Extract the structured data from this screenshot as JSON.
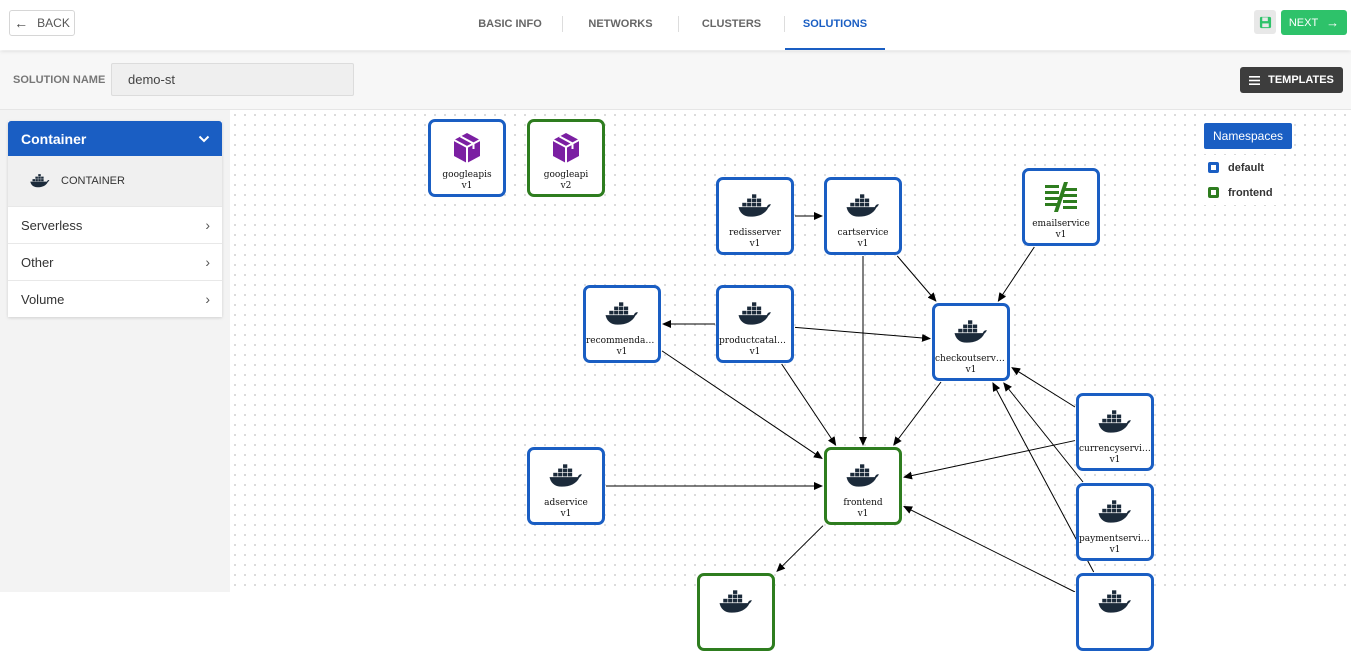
{
  "header": {
    "back_label": "BACK",
    "tabs": [
      {
        "label": "BASIC INFO",
        "active": false
      },
      {
        "label": "NETWORKS",
        "active": false
      },
      {
        "label": "CLUSTERS",
        "active": false
      },
      {
        "label": "SOLUTIONS",
        "active": true
      }
    ],
    "next_label": "NEXT"
  },
  "solution": {
    "name_label": "SOLUTION NAME",
    "name_value": "demo-st",
    "templates_label": "TEMPLATES"
  },
  "sidebar": {
    "open_section": "Container",
    "open_items": [
      {
        "label": "CONTAINER",
        "icon": "docker-icon"
      }
    ],
    "sections": [
      "Serverless",
      "Other",
      "Volume"
    ]
  },
  "namespaces": {
    "title": "Namespaces",
    "items": [
      {
        "label": "default",
        "color": "#1a5ec3"
      },
      {
        "label": "frontend",
        "color": "#2e7d1f"
      }
    ]
  },
  "colors": {
    "accent": "#1a5ec3",
    "frontend": "#2e7d1f",
    "next": "#2ec26a",
    "package": "#7b1fa2"
  },
  "graph": {
    "nodes": [
      {
        "id": "googleapis",
        "name": "googleapis",
        "version": "v1",
        "namespace": "default",
        "icon": "package-icon"
      },
      {
        "id": "googleapi",
        "name": "googleapi",
        "version": "v2",
        "namespace": "frontend",
        "icon": "package-icon"
      },
      {
        "id": "redisserver",
        "name": "redisserver",
        "version": "v1",
        "namespace": "default",
        "icon": "docker-icon"
      },
      {
        "id": "cartservice",
        "name": "cartservice",
        "version": "v1",
        "namespace": "default",
        "icon": "docker-icon"
      },
      {
        "id": "emailservice",
        "name": "emailservice",
        "version": "v1",
        "namespace": "default",
        "icon": "email-service-icon"
      },
      {
        "id": "recommendation",
        "name": "recommendatio…",
        "version": "v1",
        "namespace": "default",
        "icon": "docker-icon"
      },
      {
        "id": "productcatalog",
        "name": "productcatalog…",
        "version": "v1",
        "namespace": "default",
        "icon": "docker-icon"
      },
      {
        "id": "checkoutservice",
        "name": "checkoutservice",
        "version": "v1",
        "namespace": "default",
        "icon": "docker-icon"
      },
      {
        "id": "currencyservice",
        "name": "currencyservice",
        "version": "v1",
        "namespace": "default",
        "icon": "docker-icon"
      },
      {
        "id": "adservice",
        "name": "adservice",
        "version": "v1",
        "namespace": "default",
        "icon": "docker-icon"
      },
      {
        "id": "frontend",
        "name": "frontend",
        "version": "v1",
        "namespace": "frontend",
        "icon": "docker-icon"
      },
      {
        "id": "paymentservice",
        "name": "paymentservice",
        "version": "v1",
        "namespace": "default",
        "icon": "docker-icon"
      },
      {
        "id": "bottom-left",
        "name": "",
        "version": "",
        "namespace": "frontend",
        "icon": "docker-icon"
      },
      {
        "id": "bottom-right",
        "name": "",
        "version": "",
        "namespace": "default",
        "icon": "docker-icon"
      }
    ],
    "edges": [
      {
        "from": "redisserver",
        "to": "cartservice"
      },
      {
        "from": "cartservice",
        "to": "checkoutservice"
      },
      {
        "from": "emailservice",
        "to": "checkoutservice"
      },
      {
        "from": "cartservice",
        "to": "frontend"
      },
      {
        "from": "productcatalog",
        "to": "recommendation"
      },
      {
        "from": "productcatalog",
        "to": "checkoutservice"
      },
      {
        "from": "productcatalog",
        "to": "frontend"
      },
      {
        "from": "recommendation",
        "to": "frontend"
      },
      {
        "from": "checkoutservice",
        "to": "frontend"
      },
      {
        "from": "currencyservice",
        "to": "checkoutservice"
      },
      {
        "from": "currencyservice",
        "to": "frontend"
      },
      {
        "from": "paymentservice",
        "to": "checkoutservice"
      },
      {
        "from": "adservice",
        "to": "frontend"
      },
      {
        "from": "frontend",
        "to": "bottom-left"
      },
      {
        "from": "bottom-right",
        "to": "frontend"
      },
      {
        "from": "bottom-right",
        "to": "checkoutservice"
      }
    ]
  }
}
